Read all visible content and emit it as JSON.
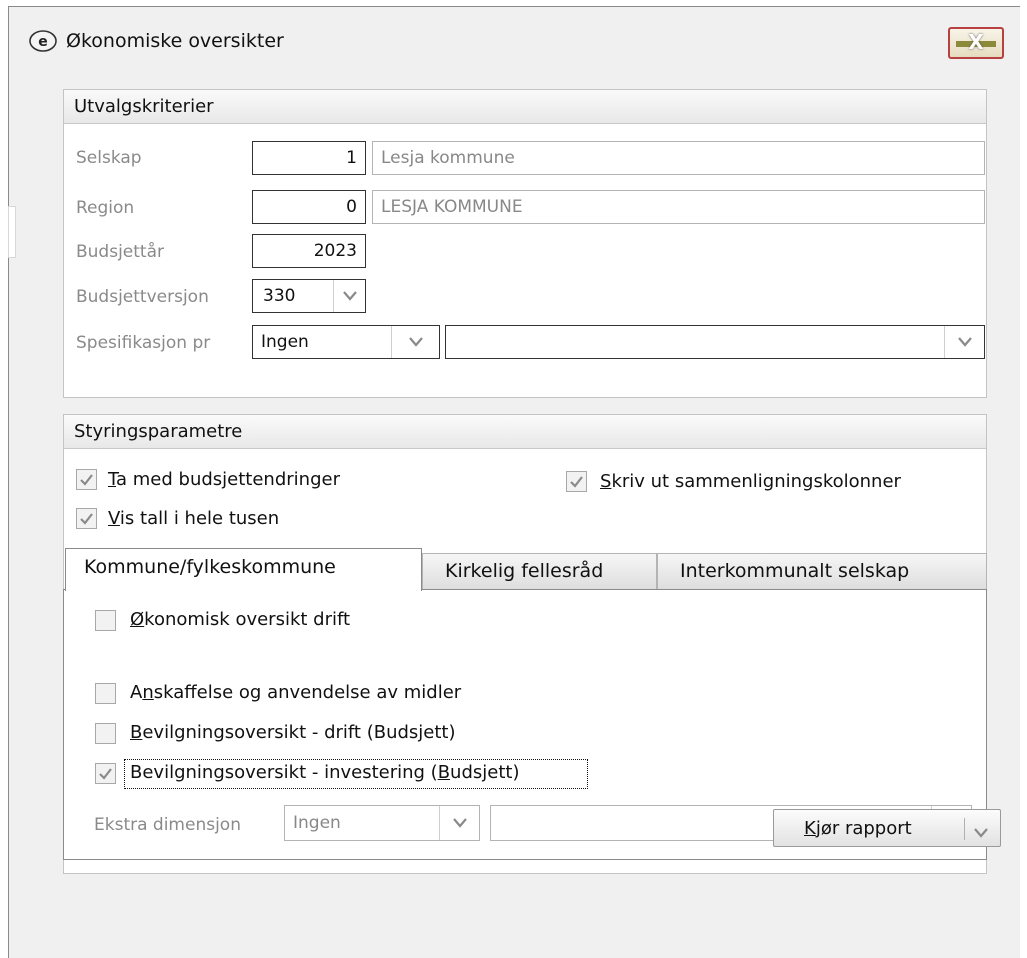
{
  "window": {
    "title": "Økonomiske oversikter",
    "close_label": "X"
  },
  "selection": {
    "header": "Utvalgskriterier",
    "company": {
      "label": "Selskap",
      "code": "1",
      "name": "Lesja kommune"
    },
    "region": {
      "label": "Region",
      "code": "0",
      "name": "LESJA KOMMUNE"
    },
    "budget_year": {
      "label": "Budsjettår",
      "value": "2023"
    },
    "budget_version": {
      "label": "Budsjettversjon",
      "value": "330"
    },
    "specification": {
      "label": "Spesifikasjon pr",
      "value": "Ingen",
      "secondary_value": ""
    }
  },
  "control": {
    "header": "Styringsparametre",
    "include_budget_changes": {
      "label": "Ta med budsjettendringer",
      "accel": "T",
      "rest": "a med budsjettendringer",
      "checked": true
    },
    "show_thousands": {
      "label": "Vis tall i hele tusen",
      "accel": "V",
      "rest": "is tall i hele tusen",
      "checked": true
    },
    "print_comparison_columns": {
      "label": "Skriv ut sammenligningskolonner",
      "accel": "S",
      "rest": "kriv ut sammenligningskolonner",
      "checked": true
    }
  },
  "tabs": [
    {
      "label": "Kommune/fylkeskommune",
      "active": true
    },
    {
      "label": "Kirkelig fellesråd",
      "active": false
    },
    {
      "label": "Interkommunalt selskap",
      "active": false
    }
  ],
  "report_options": [
    {
      "label": "Økonomisk oversikt drift",
      "accel": "Ø",
      "rest": "konomisk oversikt drift",
      "checked": false
    },
    {
      "label": "Anskaffelse og anvendelse av midler",
      "pre": "A",
      "accel": "n",
      "rest": "skaffelse og anvendelse av midler",
      "checked": false
    },
    {
      "label": "Bevilgningsoversikt - drift (Budsjett)",
      "accel": "B",
      "rest": "evilgningsoversikt - drift (Budsjett)",
      "checked": false
    },
    {
      "label": "Bevilgningsoversikt - investering (Budsjett)",
      "pre": "Bevilgningsoversikt - investering (",
      "accel": "B",
      "rest": "udsjett)",
      "checked": true
    }
  ],
  "extra_dimension": {
    "label": "Ekstra dimensjon",
    "value": "Ingen",
    "secondary_value": ""
  },
  "run_button": {
    "label": "Kjør rapport",
    "accel": "K",
    "rest": "jør rapport"
  },
  "colors": {
    "close_border": "#b84040",
    "dialog_bg": "#f0f0f0",
    "label_gray": "#8a8a8a"
  }
}
